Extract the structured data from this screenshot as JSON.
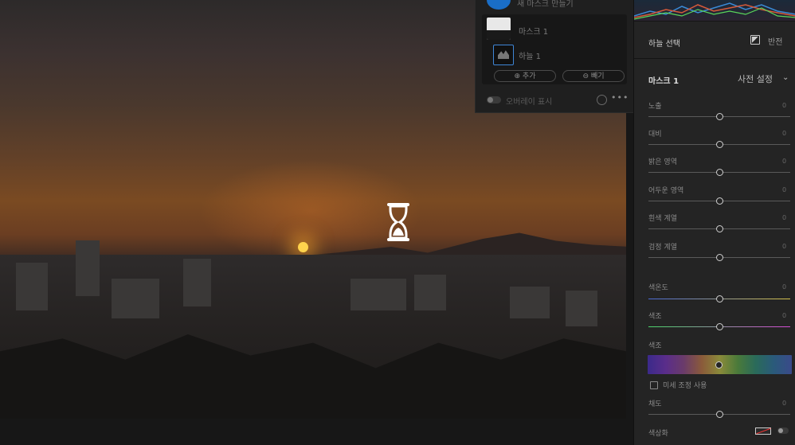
{
  "mask_panel": {
    "new_mask_label": "새 마스크 만들기",
    "mask_name": "마스크 1",
    "sub_mask_name": "하늘 1",
    "add_label": "추가",
    "subtract_label": "빼기",
    "overlay_label": "오버레이 표시",
    "more_label": "•••"
  },
  "right_panel": {
    "sky_select_label": "하늘 선택",
    "invert_label": "반전",
    "mask_title": "마스크 1",
    "preset_label": "사전 설정",
    "sliders": [
      {
        "label": "노출",
        "value": "0"
      },
      {
        "label": "대비",
        "value": "0"
      },
      {
        "label": "밝은 영역",
        "value": "0"
      },
      {
        "label": "어두운 영역",
        "value": "0"
      },
      {
        "label": "흰색 계열",
        "value": "0"
      },
      {
        "label": "검정 계열",
        "value": "0"
      },
      {
        "label": "색온도",
        "value": "0"
      },
      {
        "label": "색조",
        "value": "0"
      },
      {
        "label": "색조",
        "value": ""
      },
      {
        "label": "채도",
        "value": "0"
      }
    ],
    "fine_adjust_label": "미세 조정 사용",
    "colorize_label": "색상화"
  },
  "colors": {
    "accent": "#1a6ec7",
    "panel_bg": "#242424"
  }
}
